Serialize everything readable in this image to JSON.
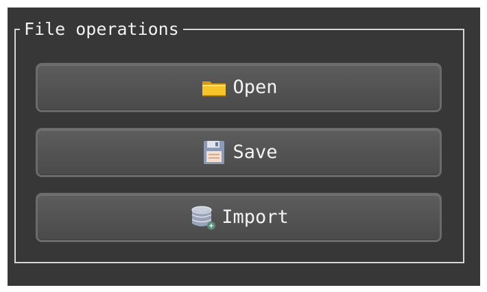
{
  "group": {
    "title": "File operations"
  },
  "buttons": {
    "open": {
      "label": "Open",
      "icon": "folder-icon"
    },
    "save": {
      "label": "Save",
      "icon": "floppy-disk-icon"
    },
    "import": {
      "label": "Import",
      "icon": "database-import-icon"
    }
  },
  "colors": {
    "background": "#373737",
    "groupbox_border": "#d8d8d8",
    "button_face": "#555555",
    "button_border": "#6b6b6b",
    "text": "#f4f4f4"
  }
}
